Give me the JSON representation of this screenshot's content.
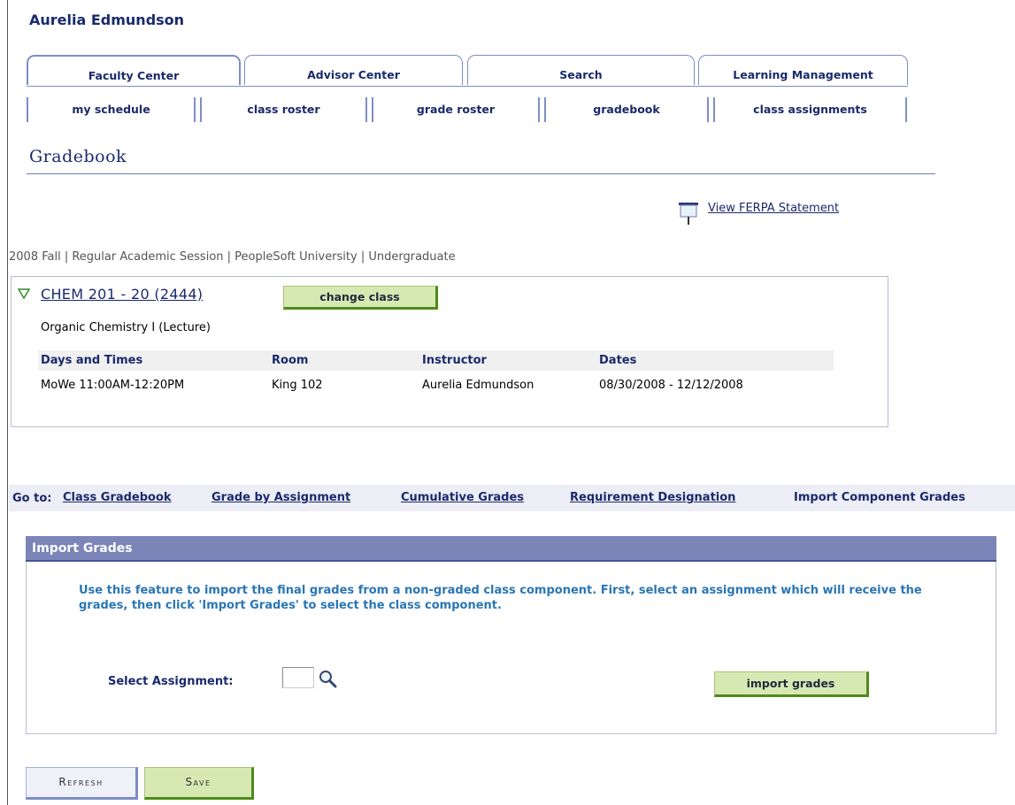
{
  "user": {
    "name": "Aurelia Edmundson"
  },
  "tabs": [
    {
      "label": "Faculty Center"
    },
    {
      "label": "Advisor Center"
    },
    {
      "label": "Search"
    },
    {
      "label": "Learning Management"
    }
  ],
  "subtabs": [
    {
      "label": "my schedule"
    },
    {
      "label": "class roster"
    },
    {
      "label": "grade roster"
    },
    {
      "label": "gradebook"
    },
    {
      "label": "class assignments"
    }
  ],
  "page": {
    "title": "Gradebook"
  },
  "ferpa": {
    "label": "View FERPA Statement",
    "icon": "projector-screen-icon"
  },
  "session": "2008 Fall | Regular Academic Session | PeopleSoft University | Undergraduate",
  "class": {
    "link": "CHEM 201 - 20 (2444)",
    "change_button": "change class",
    "description": "Organic Chemistry I (Lecture)",
    "columns": [
      "Days and Times",
      "Room",
      "Instructor",
      "Dates"
    ],
    "row": [
      "MoWe 11:00AM-12:20PM",
      "King 102",
      "Aurelia Edmundson",
      "08/30/2008 - 12/12/2008"
    ]
  },
  "goto": {
    "label": "Go to:",
    "links": [
      "Class Gradebook",
      "Grade by Assignment",
      "Cumulative Grades",
      "Requirement Designation",
      "Import Component Grades"
    ]
  },
  "import": {
    "title": "Import Grades",
    "instructions": "Use this feature to import the final grades from a non-graded class component. First, select an assignment which will receive the grades, then click 'Import Grades' to select the class component.",
    "select_label": "Select Assignment:",
    "select_value": "",
    "button": "import grades"
  },
  "actions": {
    "refresh": "Refresh",
    "save": "Save"
  },
  "colors": {
    "brand": "#1a2a6c",
    "header_bar": "#7b85b8",
    "green_button": "#d7e9b3",
    "instruction_text": "#2a76b5"
  }
}
